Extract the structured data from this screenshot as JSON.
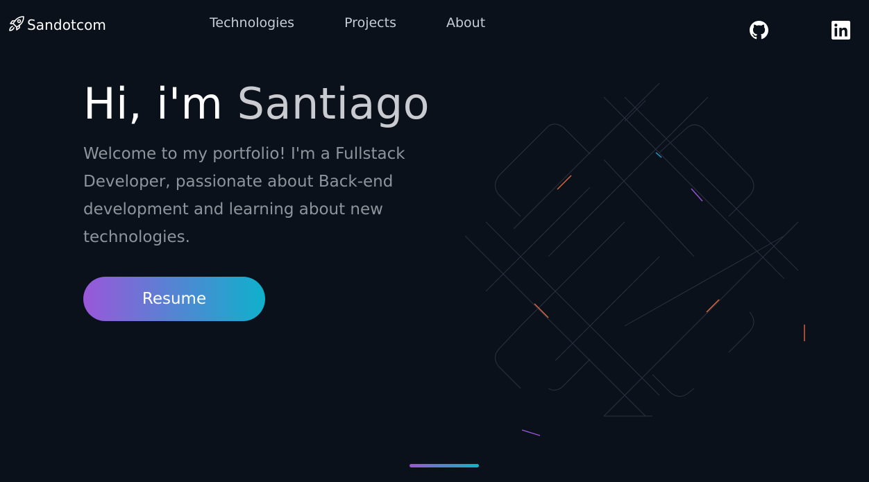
{
  "header": {
    "logo": {
      "text": "Sandotcom",
      "icon": "rocket-icon"
    },
    "nav": [
      {
        "label": "Technologies"
      },
      {
        "label": "Projects"
      },
      {
        "label": "About"
      }
    ],
    "social": [
      {
        "icon": "github-icon"
      },
      {
        "icon": "linkedin-icon"
      }
    ]
  },
  "hero": {
    "greeting": "Hi, i'm",
    "name": "Santiago",
    "description": "Welcome to my portfolio! I'm a Fullstack Developer, passionate about Back-end development and learning about new technologies.",
    "resume_button": "Resume"
  },
  "colors": {
    "background": "#0b111b",
    "gradient_start": "#9a57d9",
    "gradient_end": "#0fb1cc",
    "nav_text": "#c7cdd6",
    "description_text": "#8f949c"
  }
}
